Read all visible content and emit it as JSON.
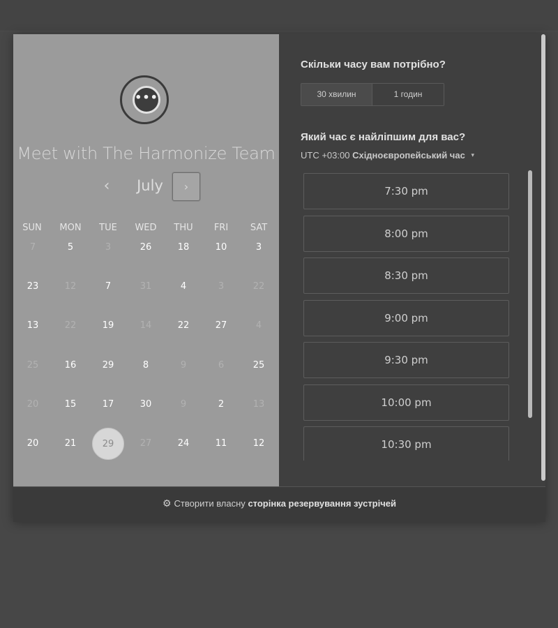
{
  "left": {
    "team_title": "Meet with The Harmonize Team",
    "logo_dots": "•••",
    "month": "July",
    "prev_icon": "‹",
    "next_icon": "›",
    "weekdays": [
      "SUN",
      "MON",
      "TUE",
      "WED",
      "THU",
      "FRI",
      "SAT"
    ],
    "weeks": [
      [
        "7",
        "5",
        "3",
        "26",
        "18",
        "10",
        "3"
      ],
      [
        "23",
        "12",
        "7",
        "31",
        "4",
        "3",
        "22"
      ],
      [
        "13",
        "22",
        "19",
        "14",
        "22",
        "27",
        "4"
      ],
      [
        "25",
        "16",
        "29",
        "8",
        "9",
        "6",
        "25"
      ],
      [
        "20",
        "15",
        "17",
        "30",
        "9",
        "2",
        "13"
      ],
      [
        "20",
        "21",
        "29",
        "27",
        "24",
        "11",
        "12"
      ]
    ],
    "available": [
      [
        false,
        true,
        false,
        true,
        true,
        true,
        true
      ],
      [
        true,
        false,
        true,
        false,
        true,
        false,
        false
      ],
      [
        true,
        false,
        true,
        false,
        true,
        true,
        false
      ],
      [
        false,
        true,
        true,
        true,
        false,
        false,
        true
      ],
      [
        false,
        true,
        true,
        true,
        false,
        true,
        false
      ],
      [
        true,
        true,
        true,
        false,
        true,
        true,
        true
      ]
    ],
    "selected": {
      "week": 5,
      "day": 2
    }
  },
  "right": {
    "duration_question": "Скільки часу вам потрібно?",
    "durations": [
      "30 хвилин",
      "1 годин"
    ],
    "time_question": "Який час є найліпшим для вас?",
    "timezone_offset": "UTC +03:00",
    "timezone_name": "Східноєвропейський час",
    "timezone_caret": "▾",
    "slots": [
      "7:30 pm",
      "8:00 pm",
      "8:30 pm",
      "9:00 pm",
      "9:30 pm",
      "10:00 pm",
      "10:30 pm"
    ]
  },
  "footer": {
    "icon": "hubspot-sprocket-icon",
    "icon_glyph": "⚙",
    "prefix": "Створити власну",
    "link": "сторінка резервування зустрічей"
  }
}
